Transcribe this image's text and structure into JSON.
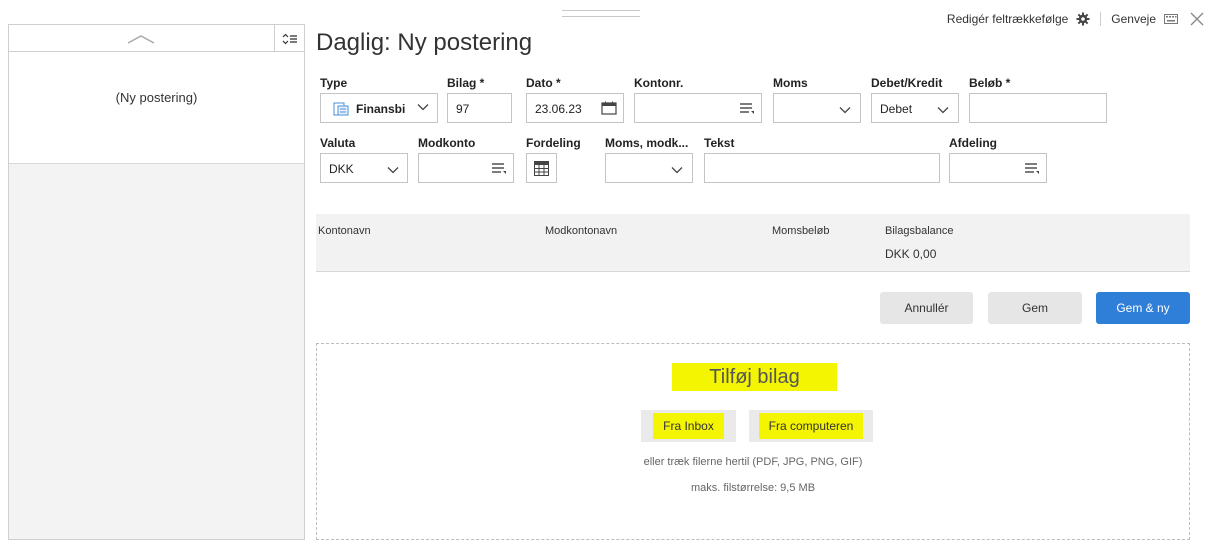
{
  "left_pane": {
    "new_item_label": "(Ny postering)"
  },
  "header": {
    "title": "Daglig: Ny postering",
    "edit_field_order_label": "Redigér feltrækkefølge",
    "shortcuts_label": "Genveje"
  },
  "form": {
    "type": {
      "label": "Type",
      "value": "Finansbi"
    },
    "bilag": {
      "label": "Bilag *",
      "value": "97"
    },
    "dato": {
      "label": "Dato *",
      "value": "23.06.23"
    },
    "kontonr": {
      "label": "Kontonr.",
      "value": ""
    },
    "moms": {
      "label": "Moms",
      "value": ""
    },
    "debet_kredit": {
      "label": "Debet/Kredit",
      "value": "Debet"
    },
    "beloeb": {
      "label": "Beløb *",
      "value": ""
    },
    "valuta": {
      "label": "Valuta",
      "value": "DKK"
    },
    "modkonto": {
      "label": "Modkonto",
      "value": ""
    },
    "fordeling": {
      "label": "Fordeling"
    },
    "moms_modkonto": {
      "label": "Moms, modk...",
      "value": ""
    },
    "tekst": {
      "label": "Tekst",
      "value": ""
    },
    "afdeling": {
      "label": "Afdeling",
      "value": ""
    }
  },
  "summary": {
    "kontonavn": "Kontonavn",
    "modkontonavn": "Modkontonavn",
    "momsbeloeb": "Momsbeløb",
    "bilagsbalance": "Bilagsbalance",
    "bilagsbalance_value": "DKK 0,00"
  },
  "actions": {
    "cancel": "Annullér",
    "save": "Gem",
    "save_new": "Gem & ny"
  },
  "attach": {
    "title": "Tilføj bilag",
    "from_inbox": "Fra Inbox",
    "from_computer": "Fra computeren",
    "hint": "eller træk filerne hertil (PDF, JPG, PNG, GIF)",
    "max_size": "maks. filstørrelse: 9,5 MB"
  },
  "colors": {
    "primary": "#2f7ed8",
    "highlight": "#f4f500",
    "summary_bg": "#f2f2f2"
  }
}
